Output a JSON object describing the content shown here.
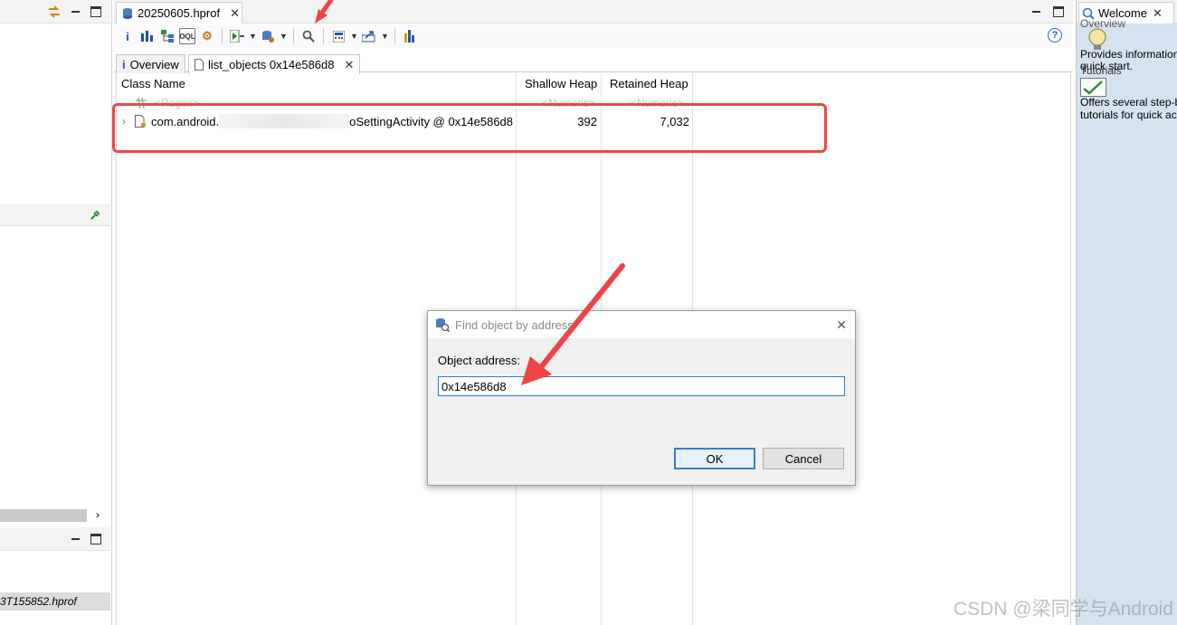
{
  "colors": {
    "highlight_box": "#e84a4a",
    "arrow": "#ee4444",
    "input_border": "#2b7bd6",
    "welcome_bg": "#d5e2ef"
  },
  "left_panel": {
    "scroll_right_icon": "chevron-right-icon",
    "bottom_item": "3T155852.hprof"
  },
  "editor": {
    "tab_title": "20250605.hprof",
    "toolbar_icons": [
      "info-icon",
      "histogram-icon",
      "dominator-tree-icon",
      "oql-icon",
      "settings-icon",
      "report-icon",
      "database-icon",
      "search-icon",
      "calculator-icon",
      "export-icon",
      "thread-icon"
    ],
    "help_icon": "?",
    "inner_tabs": [
      {
        "label": "Overview",
        "icon": "info-icon"
      },
      {
        "label": "list_objects 0x14e586d8",
        "icon": "document-icon"
      }
    ],
    "columns": [
      "Class Name",
      "Shallow Heap",
      "Retained Heap"
    ],
    "filters": [
      "<Regex>",
      "<Numeric>",
      "<Numeric>"
    ],
    "row": {
      "class_prefix": "com.android.",
      "class_suffix": "oSettingActivity @ 0x14e586d8",
      "shallow_heap": "392",
      "retained_heap": "7,032"
    }
  },
  "welcome": {
    "tab_title": "Welcome",
    "overview_heading": "Overview",
    "overview_text_1": "Provides information",
    "overview_text_2": "quick start.",
    "tutorials_heading": "Tutorials",
    "tutorials_text_1": "Offers several step-b",
    "tutorials_text_2": "tutorials for quick acc"
  },
  "dialog": {
    "title": "Find object by address",
    "label": "Object address:",
    "value": "0x14e586d8",
    "ok_label": "OK",
    "cancel_label": "Cancel"
  },
  "watermark": "CSDN @梁同学与Android"
}
